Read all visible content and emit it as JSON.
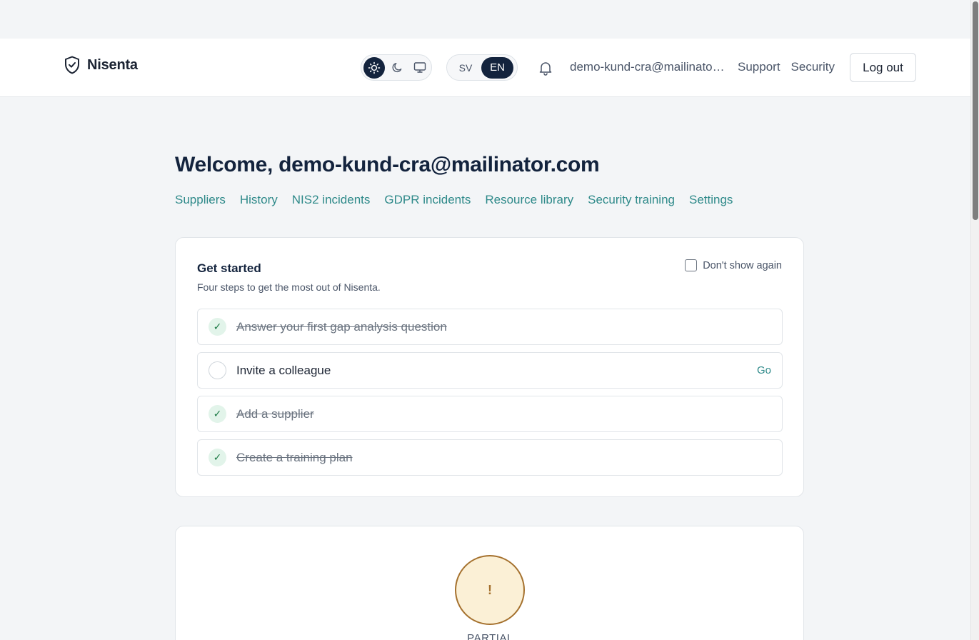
{
  "app": {
    "brand": "Nisenta"
  },
  "header": {
    "theme_options": [
      {
        "icon": "sun-icon",
        "active": true
      },
      {
        "icon": "moon-icon",
        "active": false
      },
      {
        "icon": "monitor-icon",
        "active": false
      }
    ],
    "languages": [
      {
        "code": "SV",
        "active": false
      },
      {
        "code": "EN",
        "active": true
      }
    ],
    "notification_icon": "bell-icon",
    "user_email": "demo-kund-cra@mailinator.com",
    "support_label": "Support",
    "security_label": "Security",
    "logout_label": "Log out"
  },
  "main": {
    "welcome": "Welcome, demo-kund-cra@mailinator.com",
    "tabs": [
      "Suppliers",
      "History",
      "NIS2 incidents",
      "GDPR incidents",
      "Resource library",
      "Security training",
      "Settings"
    ]
  },
  "get_started": {
    "title": "Get started",
    "subtitle": "Four steps to get the most out of Nisenta.",
    "dont_show_label": "Don't show again",
    "dont_show_checked": false,
    "steps": [
      {
        "label": "Answer your first gap analysis question",
        "done": true
      },
      {
        "label": "Invite a colleague",
        "done": false,
        "action": "Go"
      },
      {
        "label": "Add a supplier",
        "done": true
      },
      {
        "label": "Create a training plan",
        "done": true
      }
    ]
  },
  "status": {
    "symbol": "!",
    "label": "PARTIAL"
  },
  "colors": {
    "accent": "#2f8a8a",
    "navy": "#13233d",
    "done_green": "#1b7a45",
    "partial_amber": "#a5712e"
  }
}
